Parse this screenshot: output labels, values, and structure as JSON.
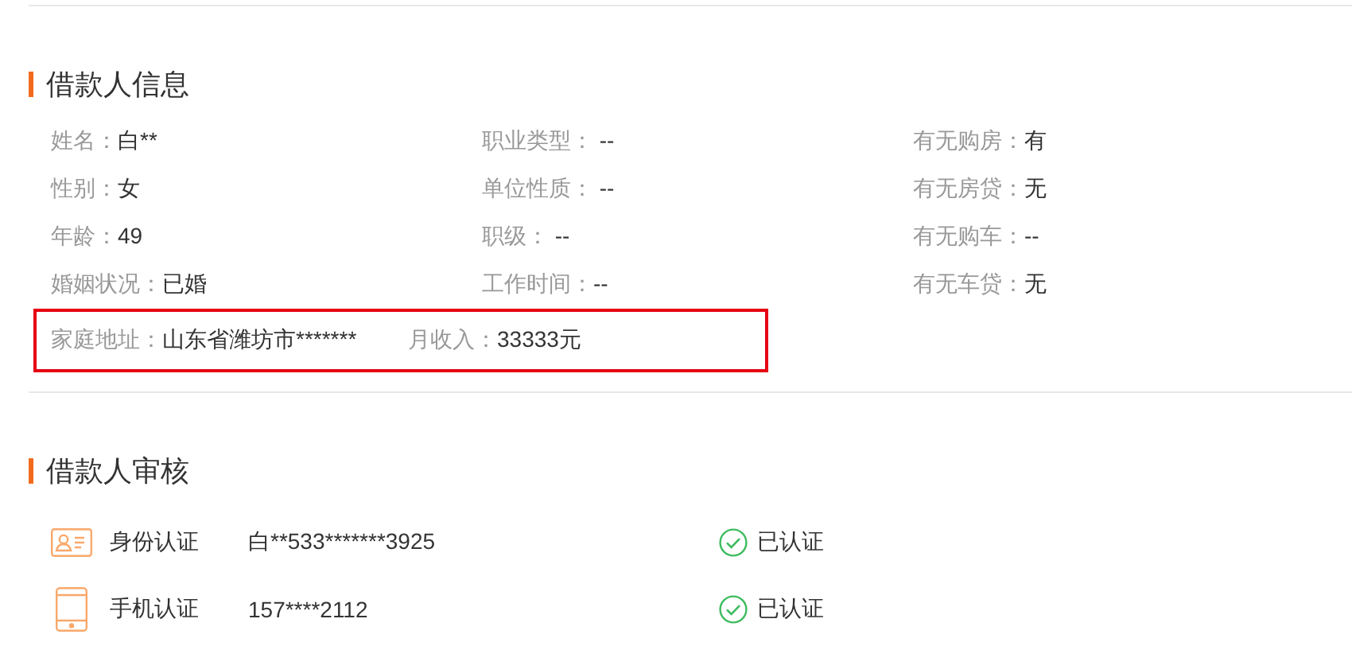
{
  "borrower_info": {
    "title": "借款人信息",
    "rows": [
      {
        "highlighted": false,
        "fields": [
          {
            "label": "姓名：",
            "value": "白**"
          },
          {
            "label": "职业类型：",
            "value": " --"
          },
          {
            "label": "有无购房：",
            "value": "有"
          }
        ]
      },
      {
        "highlighted": false,
        "fields": [
          {
            "label": "性别：",
            "value": "女"
          },
          {
            "label": "单位性质：",
            "value": " --"
          },
          {
            "label": "有无房贷：",
            "value": "无"
          }
        ]
      },
      {
        "highlighted": false,
        "fields": [
          {
            "label": "年龄：",
            "value": "49"
          },
          {
            "label": "职级：",
            "value": " --"
          },
          {
            "label": "有无购车：",
            "value": "--"
          }
        ]
      },
      {
        "highlighted": false,
        "fields": [
          {
            "label": "婚姻状况：",
            "value": "已婚"
          },
          {
            "label": "工作时间：",
            "value": "--"
          },
          {
            "label": "有无车贷：",
            "value": "无"
          }
        ]
      },
      {
        "highlighted": true,
        "fields": [
          {
            "label": "家庭地址：",
            "value": "山东省潍坊市*******"
          },
          {
            "label": "月收入：",
            "value": "33333元"
          }
        ]
      }
    ]
  },
  "borrower_audit": {
    "title": "借款人审核",
    "items": [
      {
        "kind": "id",
        "label": "身份认证",
        "value": "白**533*******3925",
        "verified": true,
        "status": "已认证"
      },
      {
        "kind": "phone",
        "label": "手机认证",
        "value": "157****2112",
        "verified": true,
        "status": "已认证"
      }
    ]
  }
}
